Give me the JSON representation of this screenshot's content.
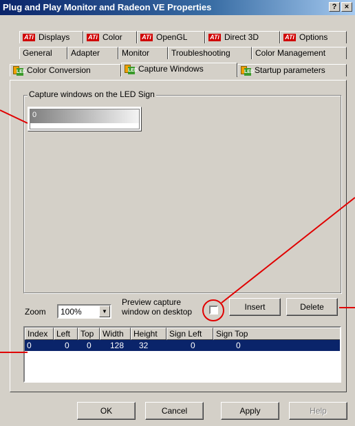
{
  "window": {
    "title": "Plug and Play Monitor and Radeon VE Properties",
    "help_btn": "?",
    "close_btn": "×"
  },
  "tabs": {
    "row1": [
      {
        "label": "Displays",
        "icon": "ati-logo-icon"
      },
      {
        "label": "Color",
        "icon": "ati-logo-icon"
      },
      {
        "label": "OpenGL",
        "icon": "ati-logo-icon"
      },
      {
        "label": "Direct 3D",
        "icon": "ati-logo-icon"
      },
      {
        "label": "Options",
        "icon": "ati-logo-icon"
      }
    ],
    "row2": [
      "General",
      "Adapter",
      "Monitor",
      "Troubleshooting",
      "Color Management"
    ],
    "row3": [
      {
        "label": "Color Conversion",
        "icon": "led-sign-icon"
      },
      {
        "label": "Capture Windows",
        "icon": "led-sign-icon",
        "active": true
      },
      {
        "label": "Startup parameters",
        "icon": "led-sign-icon"
      }
    ],
    "ati_badge": "ATi",
    "led_badge": "LED"
  },
  "capture_group": {
    "label": "Capture windows on the LED Sign",
    "window_index": "0"
  },
  "zoom": {
    "label": "Zoom",
    "value": "100%"
  },
  "preview": {
    "label_line1": "Preview capture",
    "label_line2": "window on desktop",
    "checked": false
  },
  "buttons": {
    "insert": "Insert",
    "delete": "Delete",
    "ok": "OK",
    "cancel": "Cancel",
    "apply": "Apply",
    "help": "Help"
  },
  "table": {
    "columns": [
      "Index",
      "Left",
      "Top",
      "Width",
      "Height",
      "Sign Left",
      "Sign Top"
    ],
    "rows": [
      [
        "0",
        "0",
        "0",
        "128",
        "32",
        "0",
        "0"
      ]
    ]
  },
  "colors": {
    "selection": "#0a246a",
    "callout": "#e00000",
    "face": "#d4d0c8"
  }
}
